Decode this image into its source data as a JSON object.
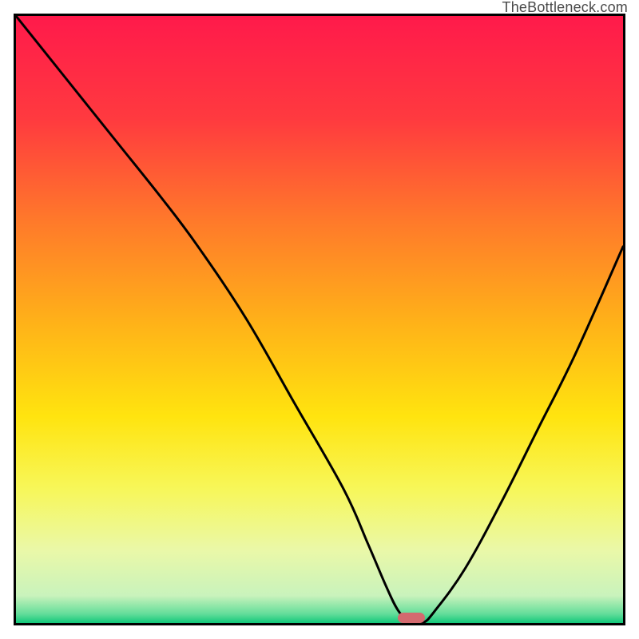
{
  "attribution": "TheBottleneck.com",
  "chart_data": {
    "type": "line",
    "title": "",
    "xlabel": "",
    "ylabel": "",
    "xlim": [
      0,
      100
    ],
    "ylim": [
      0,
      100
    ],
    "gradient_stops": [
      {
        "offset": 0.0,
        "color": "#ff1a4b"
      },
      {
        "offset": 0.17,
        "color": "#ff3a3f"
      },
      {
        "offset": 0.34,
        "color": "#ff7a2a"
      },
      {
        "offset": 0.5,
        "color": "#ffb019"
      },
      {
        "offset": 0.66,
        "color": "#ffe40f"
      },
      {
        "offset": 0.78,
        "color": "#f7f75a"
      },
      {
        "offset": 0.88,
        "color": "#eaf8a8"
      },
      {
        "offset": 0.955,
        "color": "#c9f3bc"
      },
      {
        "offset": 0.985,
        "color": "#63dd9a"
      },
      {
        "offset": 1.0,
        "color": "#11c87a"
      }
    ],
    "series": [
      {
        "name": "bottleneck-curve",
        "x": [
          0,
          8,
          16,
          24,
          30,
          38,
          46,
          54,
          58,
          61,
          63,
          65,
          67,
          69,
          74,
          80,
          86,
          92,
          100
        ],
        "y": [
          100,
          90,
          80,
          70,
          62,
          50,
          36,
          22,
          13,
          6,
          2,
          0,
          0,
          2,
          9,
          20,
          32,
          44,
          62
        ]
      }
    ],
    "marker": {
      "x": 65,
      "y": 0,
      "color": "#d46a6f",
      "shape": "pill"
    }
  }
}
